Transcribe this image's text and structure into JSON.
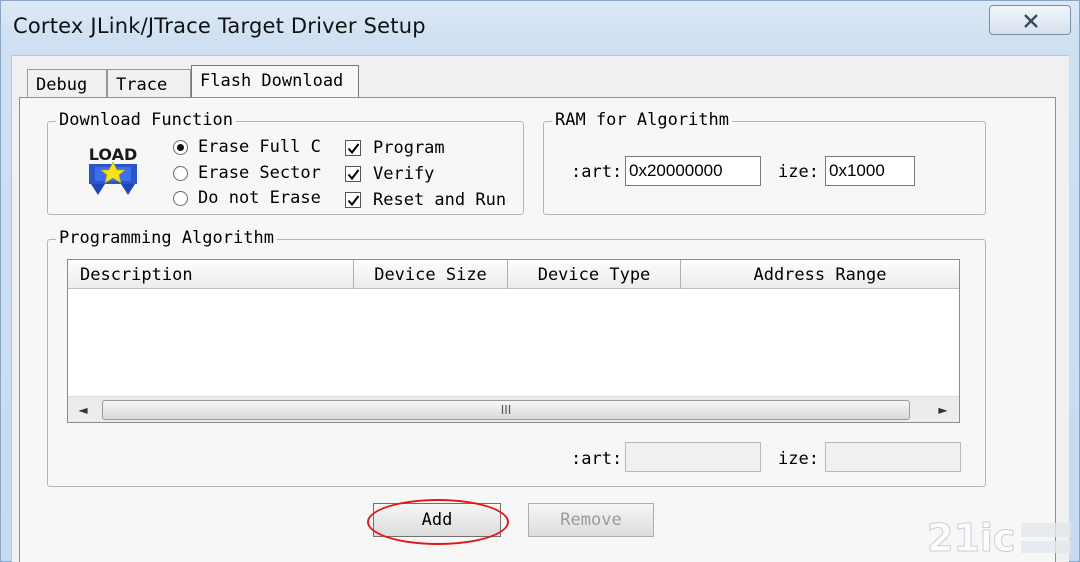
{
  "window": {
    "title": "Cortex JLink/JTrace Target Driver Setup",
    "close_icon": "close-icon"
  },
  "tabs": [
    {
      "label": "Debug",
      "active": false
    },
    {
      "label": "Trace",
      "active": false
    },
    {
      "label": "Flash Download",
      "active": true
    }
  ],
  "download_function": {
    "title": "Download Function",
    "load_icon_text": "LOAD",
    "radios": [
      {
        "label": "Erase Full C",
        "selected": true
      },
      {
        "label": "Erase Sector",
        "selected": false
      },
      {
        "label": "Do not Erase",
        "selected": false
      }
    ],
    "checks": [
      {
        "label": "Program",
        "checked": true
      },
      {
        "label": "Verify",
        "checked": true
      },
      {
        "label": "Reset and Run",
        "checked": true
      }
    ]
  },
  "ram_for_algorithm": {
    "title": "RAM for Algorithm",
    "start_label": ":art:",
    "start_value": "0x20000000",
    "size_label": "ize:",
    "size_value": "0x1000"
  },
  "programming_algorithm": {
    "title": "Programming Algorithm",
    "columns": [
      "Description",
      "Device Size",
      "Device Type",
      "Address Range"
    ],
    "rows": [],
    "scroll_left": "◄",
    "scroll_right": "►",
    "scroll_grip": "III",
    "start_label": ":art:",
    "start_value": "",
    "size_label": "ize:",
    "size_value": ""
  },
  "buttons": {
    "add": "Add",
    "remove": "Remove"
  },
  "colors": {
    "highlight_ring": "#e01818"
  }
}
